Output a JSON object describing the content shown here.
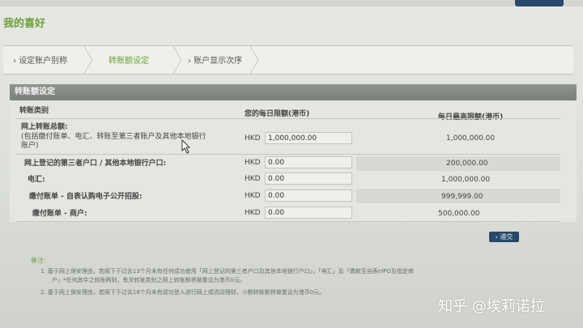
{
  "title": "我的喜好",
  "tabs": [
    {
      "label": "设定账户别称"
    },
    {
      "label": "转账额设定"
    },
    {
      "label": "账户显示次序"
    }
  ],
  "panel_title": "转账额设定",
  "columns": {
    "category": "转账类别",
    "daily_limit": "您的每日限额(港币)",
    "max_limit": "每日最高限额(港币)"
  },
  "rows": [
    {
      "label": "网上转账总额:",
      "label2": "(包括缴付账单、电汇、转账至第三者账户及其他本地银行",
      "label3": "账户)",
      "currency": "HKD",
      "value": "1,000,000.00",
      "max": "1,000,000.00"
    },
    {
      "label": "网上登记的第三者户口 / 其他本地银行户口:",
      "currency": "HKD",
      "value": "0.00",
      "max": "200,000.00"
    },
    {
      "label": "电汇:",
      "currency": "HKD",
      "value": "0.00",
      "max": "1,000,000.00"
    },
    {
      "label": "缴付账单 - 自表认购电子公开招股:",
      "currency": "HKD",
      "value": "0.00",
      "max": "999,999.00"
    },
    {
      "label": "缴付账单 - 商户:",
      "currency": "HKD",
      "value": "0.00",
      "max": "500,000.00"
    }
  ],
  "submit_label": "递交",
  "notes": {
    "heading": "备注:",
    "n1": "1.  基于网上保安理由，若阁下于过去13个月未有任何成功使用「网上登记的第三者户口及其他本地银行户口」，「电汇」及「缴款至自表eIPO及指定商",
    "n1b": "户」*任何其中之转账两则，有关转账类别之网上转账额将被重设为港币0元。",
    "n2": "2.  基于网上保安理由，若阁下于过去18个月未有成功登入进行网上或流动理财，小额转账额将被重设为港币0元。"
  },
  "watermark": "知乎 @埃莉诺拉"
}
